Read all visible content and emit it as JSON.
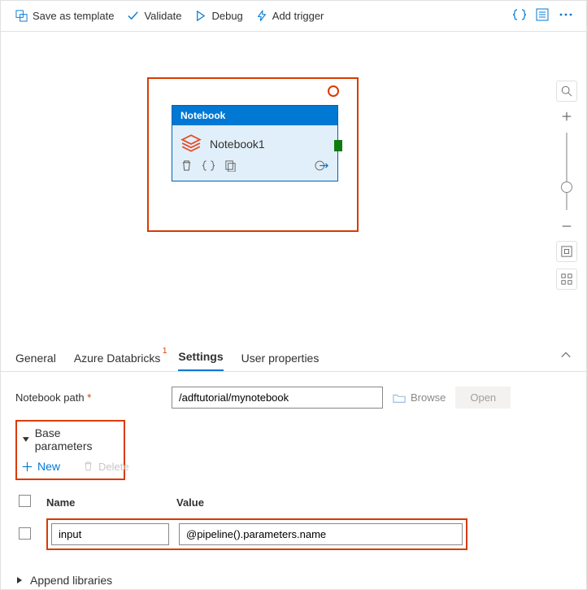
{
  "toolbar": {
    "save_template": "Save as template",
    "validate": "Validate",
    "debug": "Debug",
    "add_trigger": "Add trigger"
  },
  "canvas": {
    "node": {
      "type_label": "Notebook",
      "title": "Notebook1"
    }
  },
  "tabs": {
    "general": "General",
    "adb": "Azure Databricks",
    "adb_badge": "1",
    "settings": "Settings",
    "user_props": "User properties"
  },
  "settings": {
    "notebook_path_label": "Notebook path",
    "notebook_path_value": "/adftutorial/mynotebook",
    "browse": "Browse",
    "open": "Open",
    "base_params_label": "Base parameters",
    "new_label": "New",
    "delete_label": "Delete",
    "col_name": "Name",
    "col_value": "Value",
    "rows": [
      {
        "name": "input",
        "value": "@pipeline().parameters.name"
      }
    ],
    "append_label": "Append libraries"
  }
}
